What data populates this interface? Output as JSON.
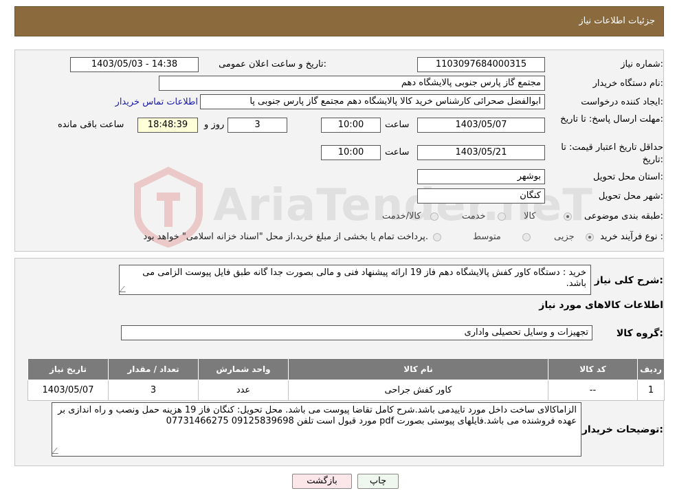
{
  "header": {
    "title": "جزئیات اطلاعات نیاز"
  },
  "form": {
    "need_number_label": "شماره نیاز:",
    "need_number": "1103097684000315",
    "announce_label": "تاریخ و ساعت اعلان عمومی:",
    "announce_value": "1403/05/03 - 14:38",
    "buyer_org_label": "نام دستگاه خریدار:",
    "buyer_org": "مجتمع گاز پارس جنوبی  پالایشگاه دهم",
    "creator_label": "ایجاد کننده درخواست:",
    "creator": "ابوالفضل صحرائی کارشناس خرید کالا پالایشگاه دهم مجتمع گاز پارس جنوبی  پا",
    "contact_link": "اطلاعات تماس خریدار",
    "reply_deadline_label": "مهلت ارسال پاسخ: تا تاریخ:",
    "reply_date": "1403/05/07",
    "time_label": "ساعت",
    "reply_time": "10:00",
    "days_value": "3",
    "days_label": "روز و",
    "remaining_time": "18:48:39",
    "remaining_label": "ساعت باقی مانده",
    "price_validity_label": "حداقل تاریخ اعتبار قیمت: تا تاریخ:",
    "price_date": "1403/05/21",
    "price_time": "10:00",
    "province_label": "استان محل تحویل:",
    "province": "بوشهر",
    "city_label": "شهر محل تحویل:",
    "city": "کنگان",
    "category_label": "طبقه بندی موضوعی:",
    "category_options": [
      "کالا",
      "خدمت",
      "کالا/خدمت"
    ],
    "process_label": "نوع فرآیند خرید :",
    "process_options": [
      "جزیی",
      "متوسط"
    ],
    "process_note": "پرداخت تمام یا بخشی از مبلغ خرید،از محل \"اسناد خزانه اسلامی\" خواهد بود."
  },
  "details": {
    "summary_label": "شرح کلی نیاز:",
    "summary": "خرید : دستگاه کاور کفش  پالایشگاه دهم فاز 19 ارائه پیشنهاد فنی و مالی بصورت جدا گانه طبق فایل پیوست الزامی می باشد.",
    "goods_info_title": "اطلاعات کالاهای مورد نیاز",
    "goods_group_label": "گروه کالا:",
    "goods_group": "تجهیزات و وسایل تحصیلی واداری",
    "table": {
      "headers": [
        "ردیف",
        "کد کالا",
        "نام کالا",
        "واحد شمارش",
        "تعداد / مقدار",
        "تاریخ نیاز"
      ],
      "rows": [
        [
          "1",
          "--",
          "کاور کفش جراحی",
          "عدد",
          "3",
          "1403/05/07"
        ]
      ]
    },
    "buyer_notes_label": "توضیحات خریدار:",
    "buyer_notes": "الزاماکالای ساخت داخل مورد تاییدمی باشد.شرح کامل تقاضا پیوست می باشد. محل تحویل: کنگان فاز 19 هزینه حمل ونصب و راه اندازی بر عهده فروشنده می باشد.فایلهای پیوستی بصورت pdf مورد قبول است  تلفن 09125839698 07731466275"
  },
  "buttons": {
    "print": "چاپ",
    "back": "بازگشت"
  },
  "watermark": {
    "text": "AriaTender.neT"
  }
}
